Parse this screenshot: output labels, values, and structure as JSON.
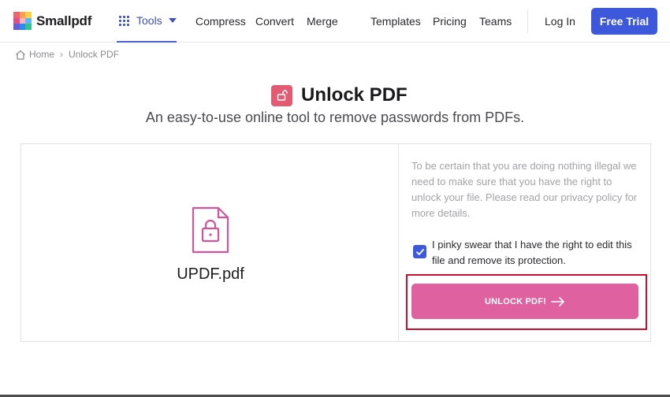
{
  "brand": {
    "name": "Smallpdf",
    "logo_colors": [
      "#f06273",
      "#ff9f4d",
      "#ffd142",
      "#e24d8b",
      "#f6b6c6",
      "#5ab9f5",
      "#6a5bd8",
      "#2e8bed",
      "#34c38f"
    ]
  },
  "nav": {
    "tools_label": "Tools",
    "links": [
      "Compress",
      "Convert",
      "Merge",
      "Templates",
      "Pricing",
      "Teams"
    ],
    "login_label": "Log In",
    "trial_label": "Free Trial"
  },
  "breadcrumb": {
    "home": "Home",
    "separator": "›",
    "current": "Unlock PDF"
  },
  "page": {
    "title": "Unlock PDF",
    "subtitle": "An easy-to-use online tool to remove passwords from PDFs."
  },
  "file": {
    "name": "UPDF.pdf",
    "icon": "locked-file-icon"
  },
  "notice": "To be certain that you are doing nothing illegal we need to make sure that you have the right to unlock your file. Please read our privacy policy for more details.",
  "consent": {
    "checked": true,
    "label": "I pinky swear that I have the right to edit this file and remove its protection."
  },
  "action": {
    "label": "UNLOCK PDF!",
    "icon": "arrow-right-icon"
  },
  "colors": {
    "accent": "#3e58dc",
    "unlock_button": "#e0619f",
    "title_icon": "#e25b72",
    "highlight": "#c8102e"
  }
}
